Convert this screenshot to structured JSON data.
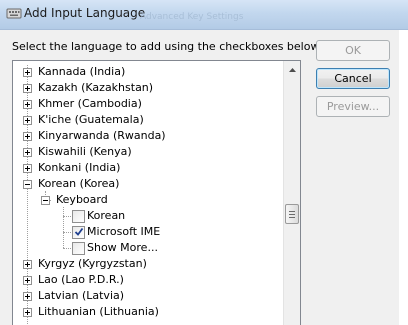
{
  "window": {
    "title": "Add Input Language",
    "background_title": "Advanced Key Settings"
  },
  "instruction": "Select the language to add using the checkboxes below.",
  "buttons": {
    "ok": "OK",
    "cancel": "Cancel",
    "preview": "Preview..."
  },
  "tree": {
    "items": [
      {
        "label": "Kannada (India)",
        "expanded": false
      },
      {
        "label": "Kazakh (Kazakhstan)",
        "expanded": false
      },
      {
        "label": "Khmer (Cambodia)",
        "expanded": false
      },
      {
        "label": "K'iche (Guatemala)",
        "expanded": false
      },
      {
        "label": "Kinyarwanda (Rwanda)",
        "expanded": false
      },
      {
        "label": "Kiswahili (Kenya)",
        "expanded": false
      },
      {
        "label": "Konkani (India)",
        "expanded": false
      },
      {
        "label": "Korean (Korea)",
        "expanded": true
      },
      {
        "label": "Keyboard",
        "expanded": true
      },
      {
        "label": "Korean",
        "checked": false
      },
      {
        "label": "Microsoft IME",
        "checked": true
      },
      {
        "label": "Show More...",
        "checked": false
      },
      {
        "label": "Kyrgyz (Kyrgyzstan)",
        "expanded": false
      },
      {
        "label": "Lao (Lao P.D.R.)",
        "expanded": false
      },
      {
        "label": "Latvian (Latvia)",
        "expanded": false
      },
      {
        "label": "Lithuanian (Lithuania)",
        "expanded": false
      }
    ]
  },
  "colors": {
    "accent": "#3c7fb1",
    "checkmark": "#1f3f8f"
  }
}
